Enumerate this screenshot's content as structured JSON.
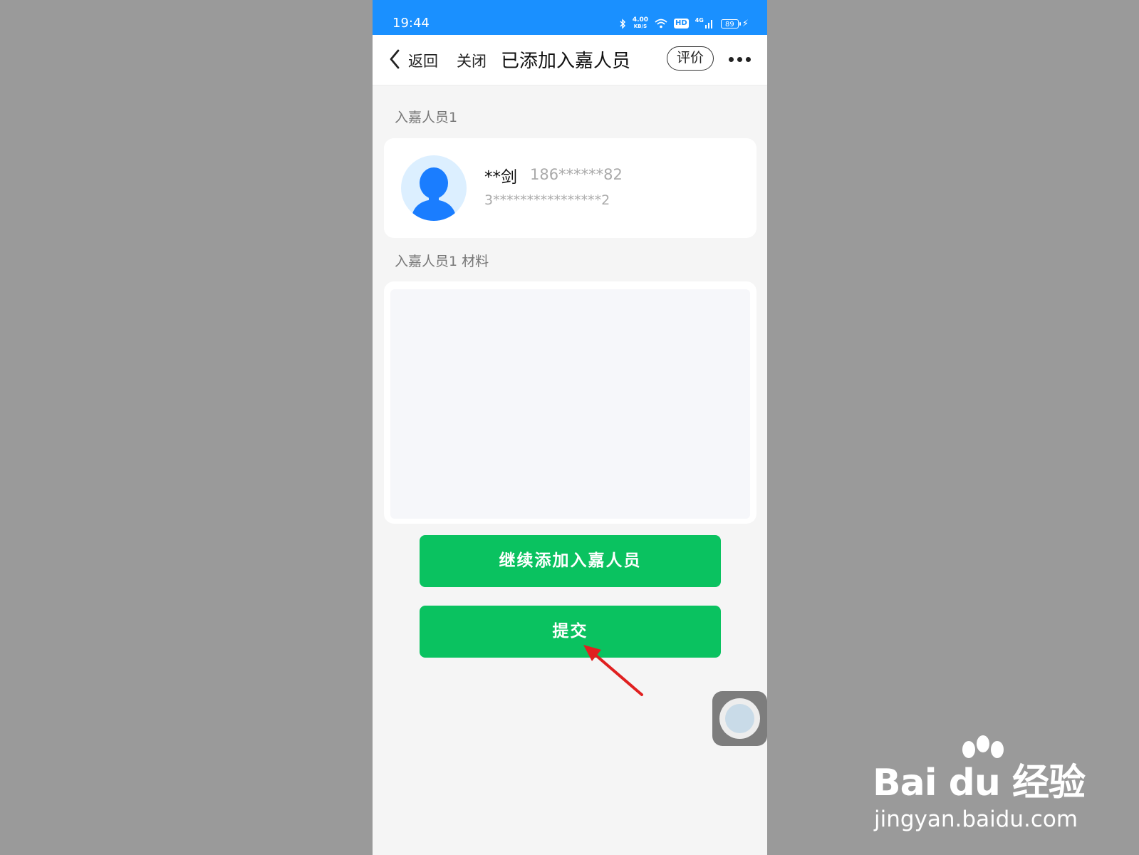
{
  "status_bar": {
    "time": "19:44",
    "speed_value": "4.00",
    "speed_unit": "KB/S",
    "hd": "HD",
    "network": "4G",
    "battery": "89"
  },
  "nav": {
    "back_label": "返回",
    "close_label": "关闭",
    "title": "已添加入嘉人员",
    "rate_label": "评价"
  },
  "person": {
    "section_label": "入嘉人员1",
    "name": "**剑",
    "phone": "186******82",
    "id_number": "3****************2"
  },
  "materials": {
    "section_label": "入嘉人员1 材料"
  },
  "actions": {
    "add_more_label": "继续添加入嘉人员",
    "submit_label": "提交"
  },
  "watermark": {
    "logo": "Bai du 经验",
    "url": "jingyan.baidu.com"
  },
  "colors": {
    "status_bar": "#1a90ff",
    "button_green": "#0ac260",
    "annotation_arrow": "#e02020"
  }
}
